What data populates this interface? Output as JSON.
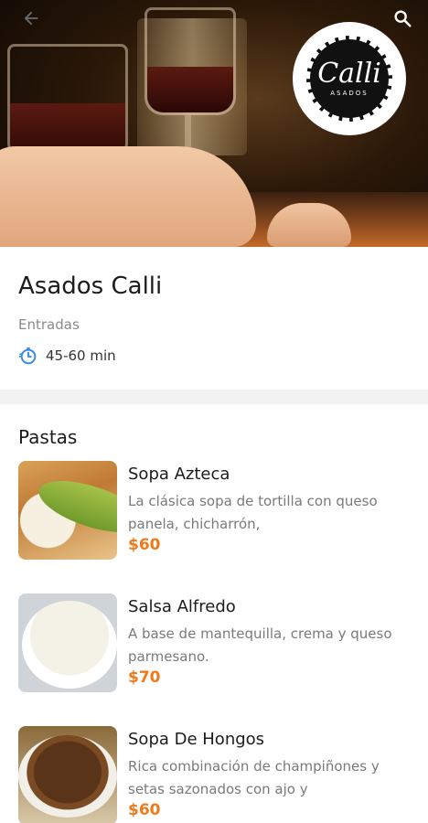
{
  "header": {
    "back_icon": "arrow-left-icon",
    "search_icon": "search-icon",
    "logo_text": "Calli",
    "logo_subtext": "ASADOS"
  },
  "restaurant": {
    "name": "Asados Calli",
    "category": "Entradas",
    "delivery_time": "45-60 min",
    "time_icon": "stopwatch-icon"
  },
  "menu": {
    "section_title": "Pastas",
    "items": [
      {
        "name": "Sopa Azteca",
        "description": "La clásica sopa de tortilla con queso panela, chicharrón,",
        "price": "$60"
      },
      {
        "name": "Salsa Alfredo",
        "description": "A base de mantequilla, crema y queso parmesano.",
        "price": "$70"
      },
      {
        "name": "Sopa De Hongos",
        "description": "Rica combinación de champiñones y setas sazonados con ajo y",
        "price": "$60"
      }
    ]
  },
  "colors": {
    "accent": "#f07a1a",
    "time_icon": "#3a8ee6"
  }
}
